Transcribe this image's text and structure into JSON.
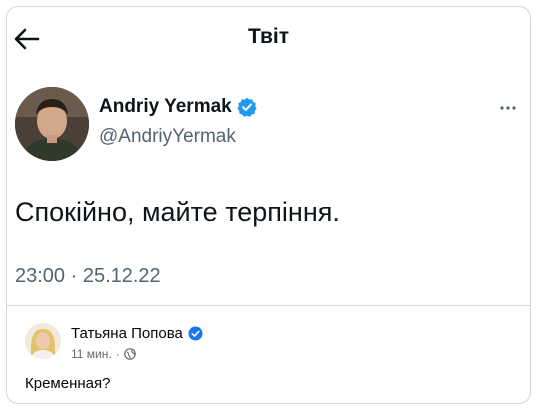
{
  "header": {
    "title": "Твіт",
    "back_icon": "arrow-left-icon"
  },
  "tweet": {
    "author_name": "Andriy Yermak",
    "author_handle": "@AndriyYermak",
    "verified_icon": "verified-badge-icon",
    "text": "Спокійно, майте терпіння.",
    "time": "23:00 · 25.12.22",
    "more_icon": "more-dots-icon"
  },
  "comment": {
    "author_name": "Татьяна Попова",
    "time": "11 мин.",
    "separator": "·",
    "privacy_icon": "globe-icon",
    "text": "Кременная?"
  },
  "colors": {
    "verified": "#1d9bf0",
    "text_secondary": "#536471",
    "fb_verified": "#1877f2"
  }
}
